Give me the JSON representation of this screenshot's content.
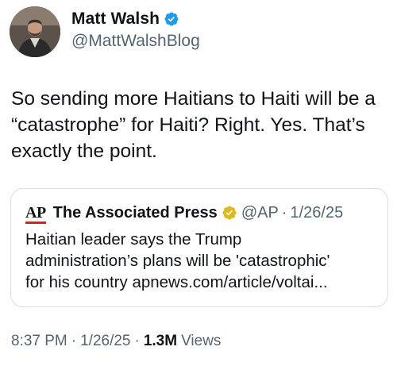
{
  "author": {
    "display_name": "Matt Walsh",
    "handle": "@MattWalshBlog",
    "verified_icon": "verified-badge-icon",
    "badge_color": "#1d9bf0"
  },
  "tweet": {
    "text": "So sending more Haitians to Haiti will be a\n“catastrophe” for Haiti? Right. Yes. That’s\nexactly the point."
  },
  "quote": {
    "logo_text": "AP",
    "logo_accent_color": "#e31b23",
    "name": "The Associated Press",
    "verified_icon": "gold-verified-badge-icon",
    "badge_color": "#e2b719",
    "handle": "@AP",
    "separator": "·",
    "date": "1/26/25",
    "text": "Haitian leader says the Trump\nadministration’s plans will be 'catastrophic'\nfor his country apnews.com/article/voltai..."
  },
  "meta": {
    "time": "8:37 PM",
    "separator": "·",
    "date": "1/26/25",
    "views_count": "1.3M",
    "views_label": "Views"
  }
}
